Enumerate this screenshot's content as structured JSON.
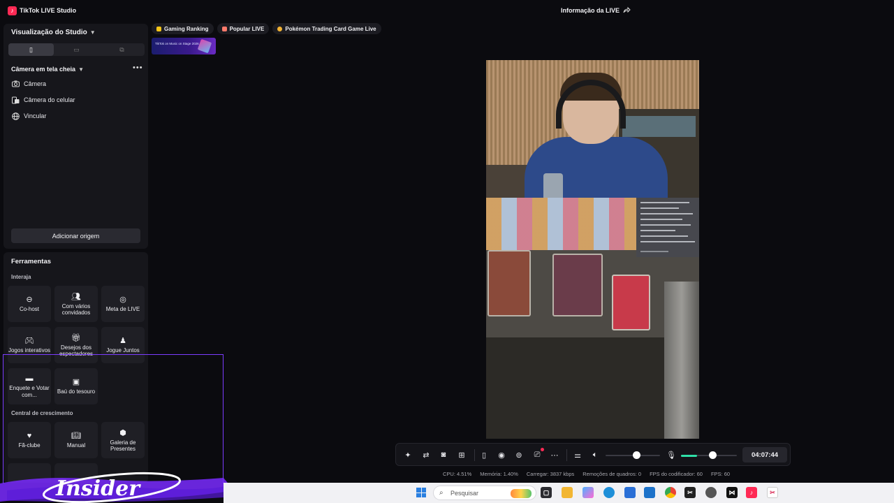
{
  "titlebar": {
    "app_title": "TikTok LIVE Studio",
    "live_info": "Informação da LIVE"
  },
  "studio": {
    "title": "Visualização do Studio",
    "scene_title": "Câmera em tela cheia",
    "sources": [
      {
        "label": "Câmera",
        "icon": "camera-icon"
      },
      {
        "label": "Câmera do celular",
        "icon": "phone-camera-icon"
      },
      {
        "label": "Vincular",
        "icon": "globe-icon"
      }
    ],
    "add_source": "Adicionar origem"
  },
  "tools": {
    "title": "Ferramentas",
    "section_interact": "Interaja",
    "section_growth": "Central de crescimento",
    "tiles": [
      {
        "label": "Co-host",
        "icon": "link-icon"
      },
      {
        "label": "Com vários convidados",
        "icon": "guests-icon"
      },
      {
        "label": "Meta de LIVE",
        "icon": "target-icon"
      },
      {
        "label": "Jogos interativos",
        "icon": "gamepad-icon"
      },
      {
        "label": "Desejos dos espectadores",
        "icon": "gift-icon"
      },
      {
        "label": "Jogue Juntos",
        "icon": "joystick-icon"
      },
      {
        "label": "Enquete e Votar com...",
        "icon": "poll-icon"
      },
      {
        "label": "Baú do tesouro",
        "icon": "chest-icon"
      },
      {
        "label": "Fã-clube",
        "icon": "heart-icon"
      },
      {
        "label": "Manual",
        "icon": "book-icon"
      },
      {
        "label": "Galeria de Presentes",
        "icon": "gallery-icon"
      }
    ]
  },
  "chips": [
    {
      "label": "Gaming Ranking",
      "color": "#f5c518"
    },
    {
      "label": "Popular LIVE",
      "color": "#ff7a6b"
    },
    {
      "label": "Pokémon Trading Card Game Live",
      "color": "#f2b233"
    }
  ],
  "banner_text": "TikTok on Music on Stage 2026",
  "controls": {
    "timer": "04:07:44"
  },
  "status": {
    "cpu": "CPU:  4.51%",
    "memory": "Memória:  1.40%",
    "upload": "Carregar:  3837 kbps",
    "dropped": "Remoções de quadros:  0",
    "encoder_fps": "FPS do codificador:  60",
    "fps": "FPS:  60"
  },
  "taskbar": {
    "search_placeholder": "Pesquisar"
  },
  "watermark": "Insider",
  "colors": {
    "accent": "#ff2a55",
    "mic_level": "#2fe0a8",
    "selection": "#7b3cff"
  }
}
